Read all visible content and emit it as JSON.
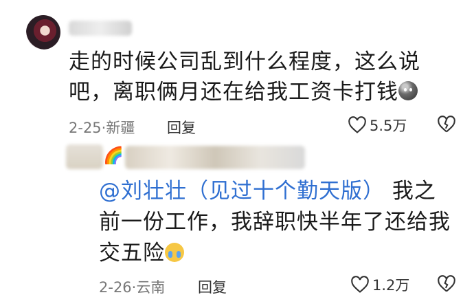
{
  "comment1": {
    "text_line1": "走的时候公司乱到什么程度，这么说",
    "text_line2": "吧，离职俩月还在给我工资卡打钱",
    "emoji": "dark-blob-face",
    "date": "2-25",
    "location": "新疆",
    "reply_label": "回复",
    "likes": "5.5万"
  },
  "comment2": {
    "mention": "@刘壮壮（见过十个勤天版）",
    "text_line1_rest": "我之",
    "text_line2": "前一份工作，我辞职快半年了还给我",
    "text_line3": "交五险",
    "emoji": "crying-face",
    "date": "2-26",
    "location": "云南",
    "reply_label": "回复",
    "likes": "1.2万"
  },
  "colors": {
    "mention": "#2f6fd1",
    "meta": "#777777"
  }
}
